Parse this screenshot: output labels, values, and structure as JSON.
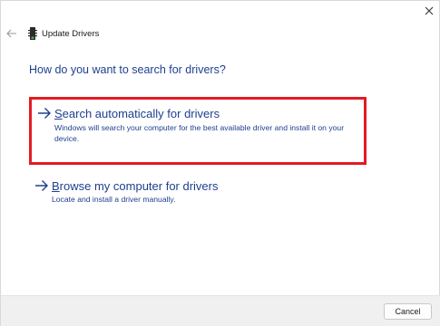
{
  "window": {
    "title": "Update Drivers",
    "close_icon": "close-icon",
    "back_icon": "back-arrow-icon",
    "device_icon": "device-icon"
  },
  "main": {
    "heading": "How do you want to search for drivers?",
    "options": [
      {
        "title_accel": "S",
        "title_rest": "earch automatically for drivers",
        "description": "Windows will search your computer for the best available driver and install it on your device.",
        "icon": "arrow-right-icon",
        "highlighted": true
      },
      {
        "title_accel": "B",
        "title_rest": "rowse my computer for drivers",
        "description": "Locate and install a driver manually.",
        "icon": "arrow-right-icon",
        "highlighted": false
      }
    ]
  },
  "footer": {
    "cancel_label": "Cancel"
  },
  "colors": {
    "link": "#1e3f8f",
    "highlight_border": "#e31b23",
    "footer_bg": "#f0f0f0"
  }
}
